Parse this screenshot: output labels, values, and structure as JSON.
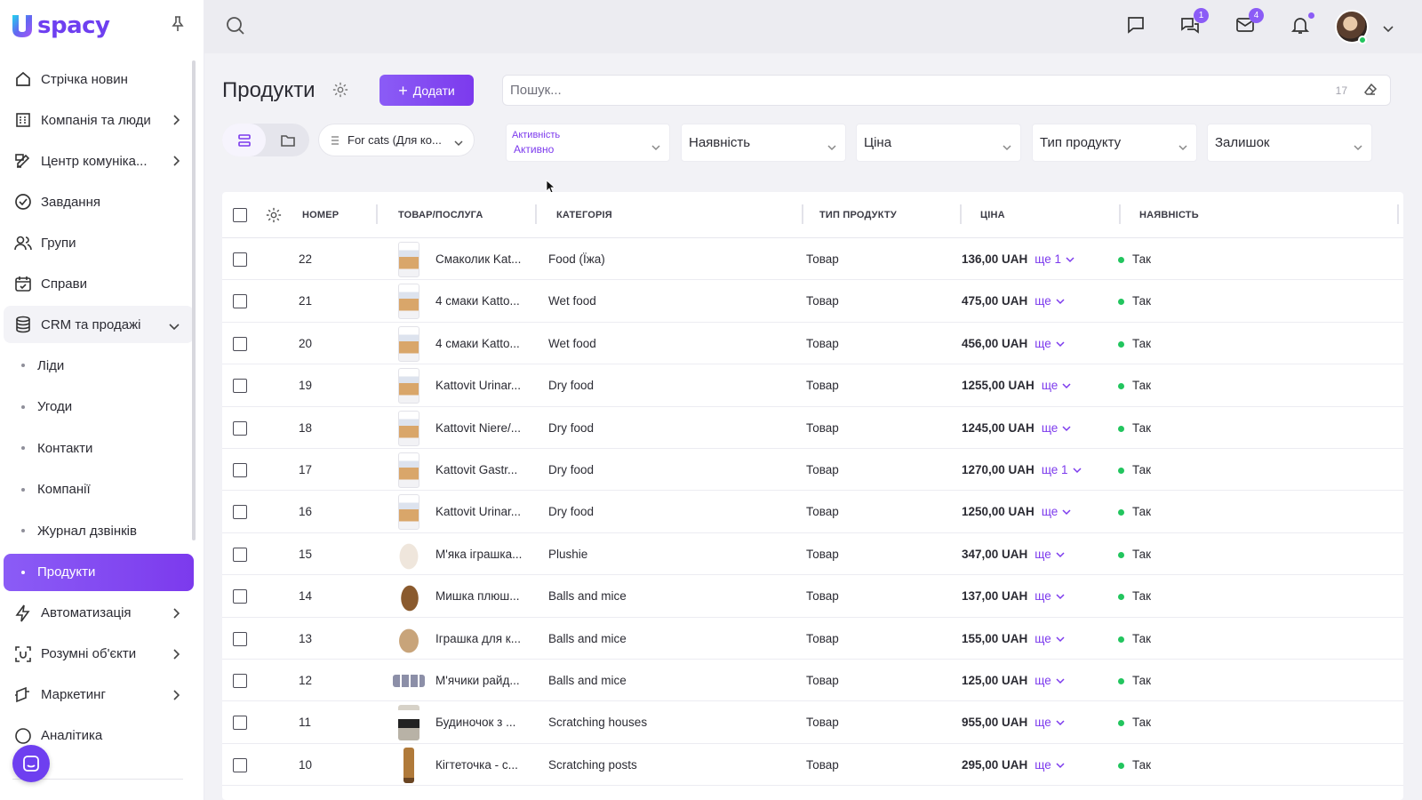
{
  "app": {
    "logo_text": "spacy"
  },
  "sidebar": {
    "items": [
      {
        "label": "Стрічка новин",
        "icon": "home-icon",
        "has_chevron": false
      },
      {
        "label": "Компанія та люди",
        "icon": "building-icon",
        "has_chevron": true
      },
      {
        "label": "Центр комуніка...",
        "icon": "edit-icon",
        "has_chevron": true
      },
      {
        "label": "Завдання",
        "icon": "check-circle-icon",
        "has_chevron": false
      },
      {
        "label": "Групи",
        "icon": "users-icon",
        "has_chevron": false
      },
      {
        "label": "Справи",
        "icon": "calendar-icon",
        "has_chevron": false
      }
    ],
    "crm": {
      "label": "CRM та продажі",
      "icon": "database-icon"
    },
    "crm_sub": [
      {
        "label": "Ліди",
        "active": false
      },
      {
        "label": "Угоди",
        "active": false
      },
      {
        "label": "Контакти",
        "active": false
      },
      {
        "label": "Компанії",
        "active": false
      },
      {
        "label": "Журнал дзвінків",
        "active": false
      },
      {
        "label": "Продукти",
        "active": true
      }
    ],
    "items_bottom": [
      {
        "label": "Автоматизація",
        "icon": "lightning-icon",
        "has_chevron": true
      },
      {
        "label": "Розумні об'єкти",
        "icon": "scan-icon",
        "has_chevron": true
      },
      {
        "label": "Маркетинг",
        "icon": "megaphone-icon",
        "has_chevron": true
      },
      {
        "label": "Аналітика",
        "icon": "chart-icon",
        "has_chevron": false
      }
    ]
  },
  "topbar": {
    "chat_badge": "1",
    "mail_badge": "4"
  },
  "page": {
    "title": "Продукти",
    "add_label": "Додати",
    "search_placeholder": "Пошук...",
    "search_count": "17",
    "category_filter": "For cats (Для ко...",
    "filters": {
      "activity_label": "Активність",
      "activity_value": "Активно",
      "availability": "Наявність",
      "price": "Ціна",
      "product_type": "Тип продукту",
      "stock": "Залишок"
    }
  },
  "table": {
    "columns": {
      "number": "НОМЕР",
      "product": "ТОВАР/ПОСЛУГА",
      "category": "КАТЕГОРІЯ",
      "type": "ТИП ПРОДУКТУ",
      "price": "ЦІНА",
      "availability": "НАЯВНІСТЬ"
    },
    "rows": [
      {
        "number": "22",
        "name": "Смаколик Kat...",
        "category": "Food (Їжа)",
        "type": "Товар",
        "price": "136,00 UAH",
        "more": "ще 1",
        "availability": "Так",
        "thumb": "bag"
      },
      {
        "number": "21",
        "name": "4 смаки Katto...",
        "category": "Wet food",
        "type": "Товар",
        "price": "475,00 UAH",
        "more": "ще",
        "availability": "Так",
        "thumb": "bag"
      },
      {
        "number": "20",
        "name": "4 смаки Katto...",
        "category": "Wet food",
        "type": "Товар",
        "price": "456,00 UAH",
        "more": "ще",
        "availability": "Так",
        "thumb": "bag"
      },
      {
        "number": "19",
        "name": "Kattovit Urinar...",
        "category": "Dry food",
        "type": "Товар",
        "price": "1255,00 UAH",
        "more": "ще",
        "availability": "Так",
        "thumb": "bag"
      },
      {
        "number": "18",
        "name": "Kattovit Niere/...",
        "category": "Dry food",
        "type": "Товар",
        "price": "1245,00 UAH",
        "more": "ще",
        "availability": "Так",
        "thumb": "bag"
      },
      {
        "number": "17",
        "name": "Kattovit Gastr...",
        "category": "Dry food",
        "type": "Товар",
        "price": "1270,00 UAH",
        "more": "ще 1",
        "availability": "Так",
        "thumb": "bag"
      },
      {
        "number": "16",
        "name": "Kattovit Urinar...",
        "category": "Dry food",
        "type": "Товар",
        "price": "1250,00 UAH",
        "more": "ще",
        "availability": "Так",
        "thumb": "bag"
      },
      {
        "number": "15",
        "name": "М'яка іграшка...",
        "category": "Plushie",
        "type": "Товар",
        "price": "347,00 UAH",
        "more": "ще",
        "availability": "Так",
        "thumb": "plush"
      },
      {
        "number": "14",
        "name": "Мишка плюш...",
        "category": "Balls and mice",
        "type": "Товар",
        "price": "137,00 UAH",
        "more": "ще",
        "availability": "Так",
        "thumb": "mouse"
      },
      {
        "number": "13",
        "name": "Іграшка для к...",
        "category": "Balls and mice",
        "type": "Товар",
        "price": "155,00 UAH",
        "more": "ще",
        "availability": "Так",
        "thumb": "toy"
      },
      {
        "number": "12",
        "name": "М'ячики райд...",
        "category": "Balls and mice",
        "type": "Товар",
        "price": "125,00 UAH",
        "more": "ще",
        "availability": "Так",
        "thumb": "balls"
      },
      {
        "number": "11",
        "name": "Будиночок з ...",
        "category": "Scratching houses",
        "type": "Товар",
        "price": "955,00 UAH",
        "more": "ще",
        "availability": "Так",
        "thumb": "house"
      },
      {
        "number": "10",
        "name": "Кігтеточка - с...",
        "category": "Scratching posts",
        "type": "Товар",
        "price": "295,00 UAH",
        "more": "ще",
        "availability": "Так",
        "thumb": "post"
      }
    ]
  },
  "colors": {
    "accent": "#7c3aed",
    "accent_light": "#8b5cf6",
    "success": "#22c55e"
  }
}
